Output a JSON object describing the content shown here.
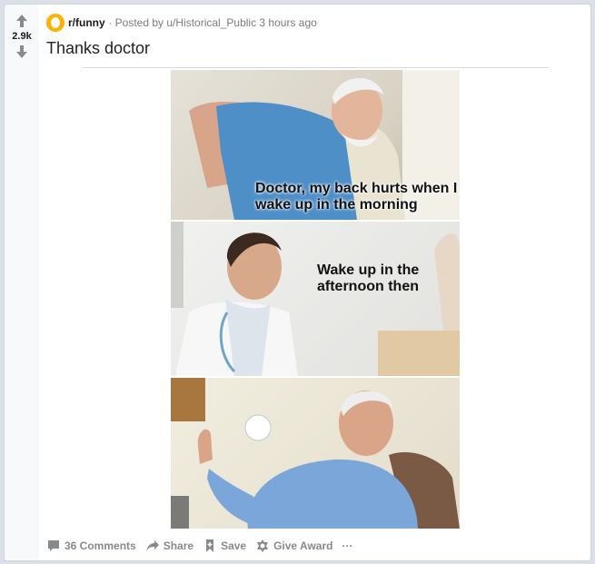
{
  "post": {
    "score": "2.9k",
    "subreddit": "r/funny",
    "separator": "·",
    "posted_by": "Posted by u/Historical_Public 3 hours ago",
    "title": "Thanks doctor",
    "image": {
      "captions": [
        "Doctor, my back hurts when I\nwake up in the morning",
        "Wake up in the\nafternoon then"
      ]
    },
    "actions": {
      "comments_label": "36 Comments",
      "share_label": "Share",
      "save_label": "Save",
      "award_label": "Give Award",
      "more_label": "···"
    }
  },
  "colors": {
    "action_gray": "#878a8c",
    "upvote_gray": "#878a8c",
    "page_bg": "#dae0e6"
  },
  "icons": [
    "arrow-up-icon",
    "arrow-down-icon",
    "comment-icon",
    "share-icon",
    "save-icon",
    "award-icon",
    "more-icon"
  ]
}
